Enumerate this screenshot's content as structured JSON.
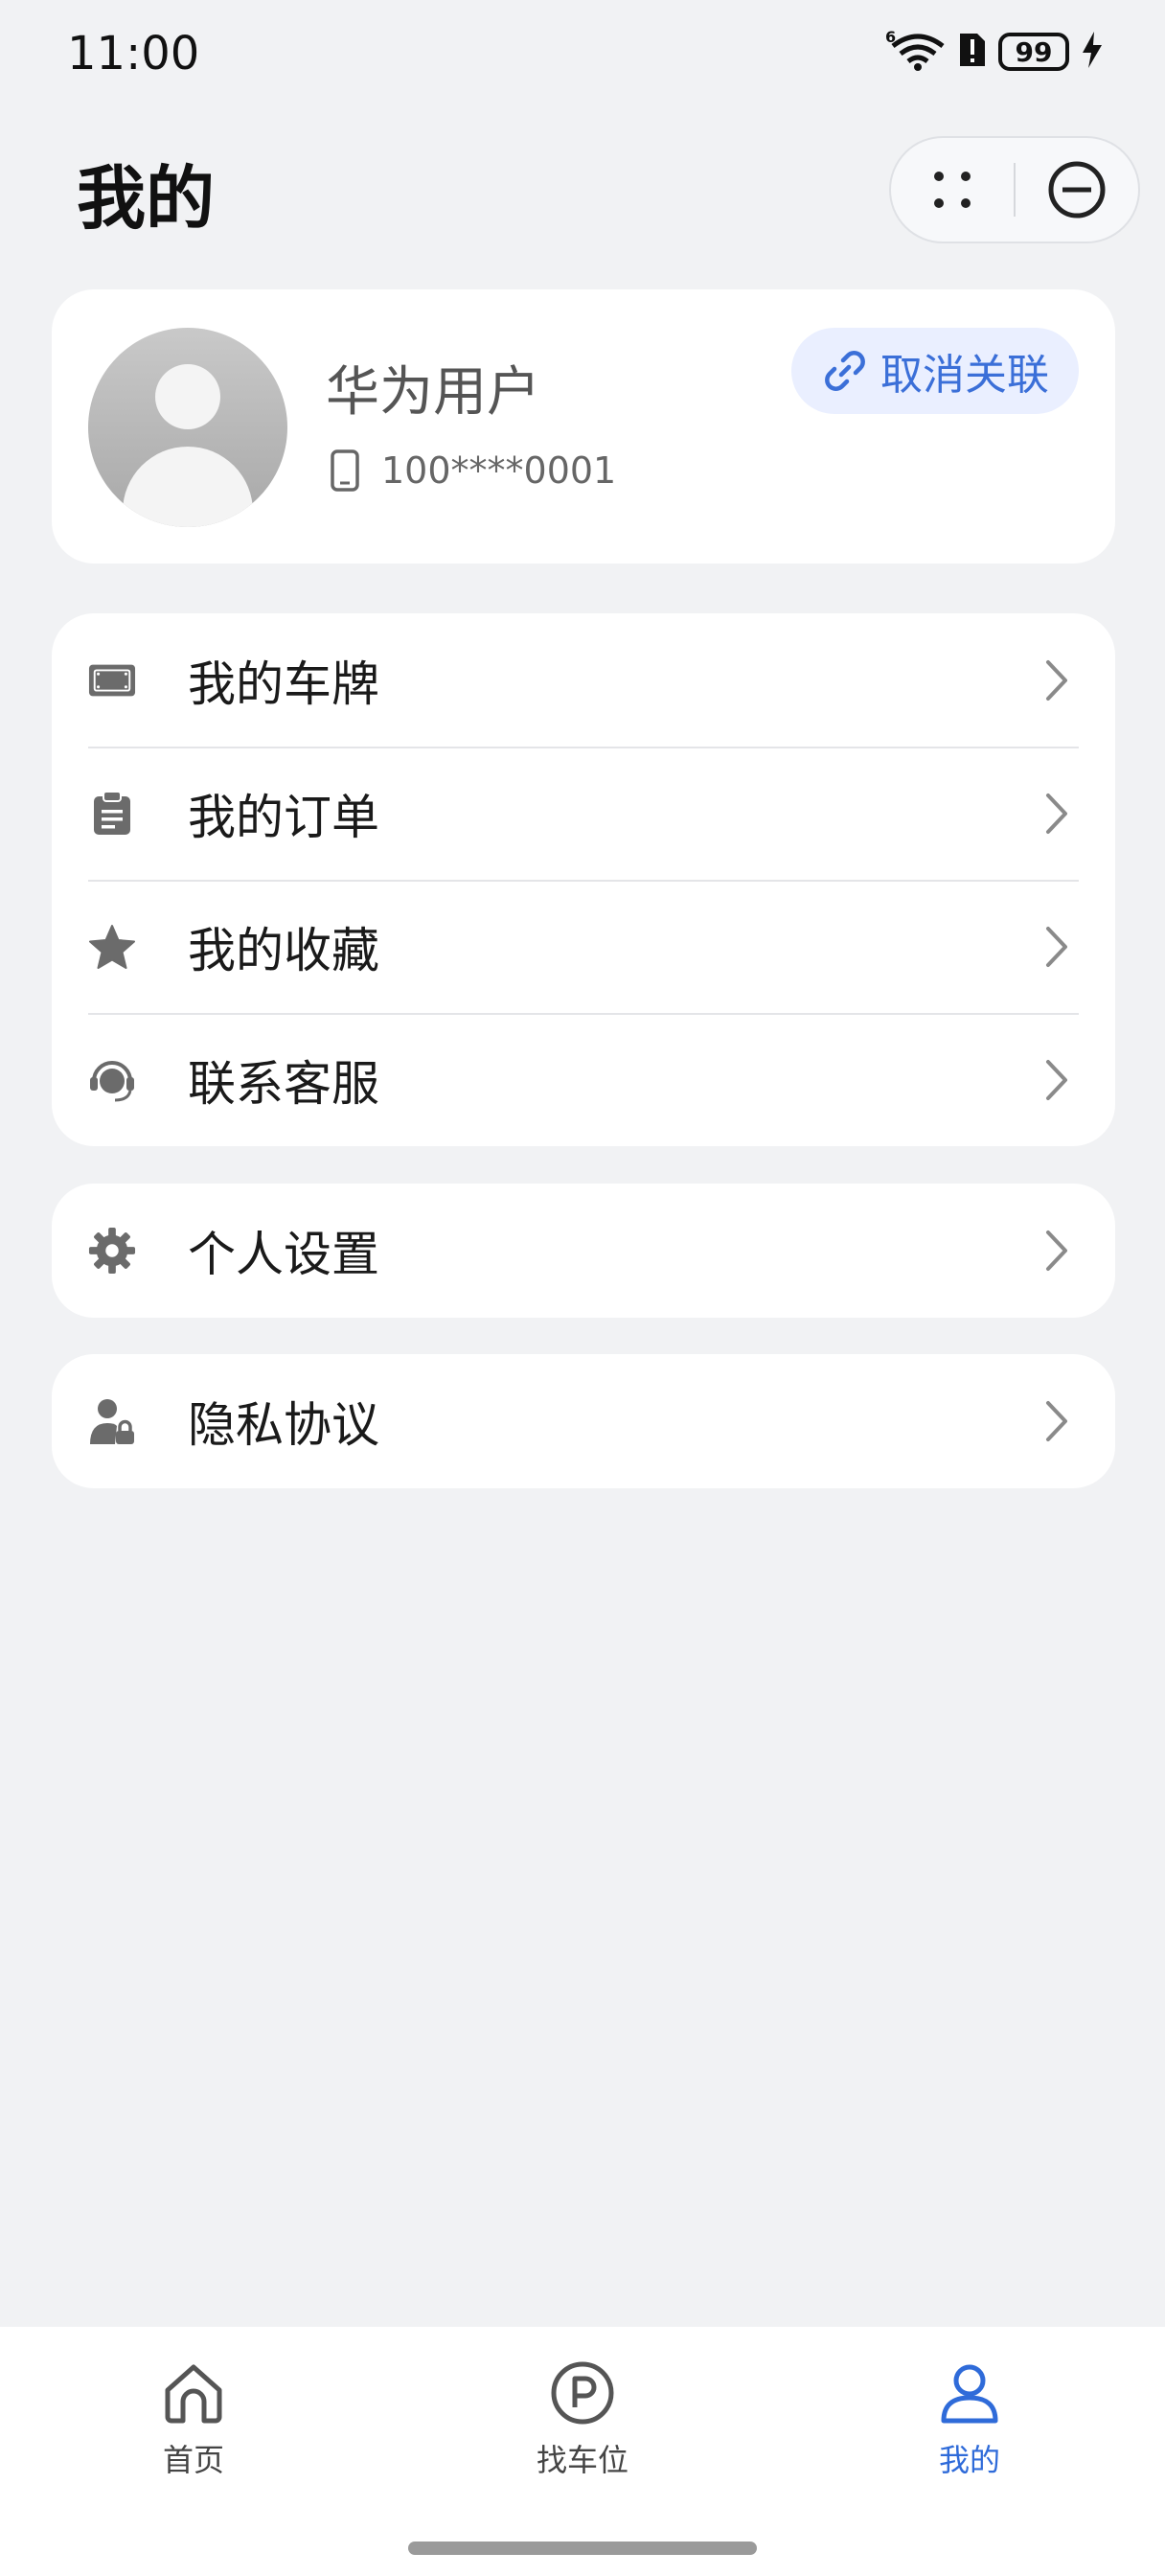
{
  "status": {
    "time": "11:00",
    "battery": "99",
    "network": "6"
  },
  "header": {
    "title": "我的"
  },
  "profile": {
    "name": "华为用户",
    "phone": "100****0001",
    "unlink_label": "取消关联"
  },
  "menu_group_1": [
    {
      "label": "我的车牌",
      "icon": "license-plate-icon"
    },
    {
      "label": "我的订单",
      "icon": "clipboard-icon"
    },
    {
      "label": "我的收藏",
      "icon": "star-icon"
    },
    {
      "label": "联系客服",
      "icon": "headset-icon"
    }
  ],
  "menu_group_2": [
    {
      "label": "个人设置",
      "icon": "gear-icon"
    }
  ],
  "menu_group_3": [
    {
      "label": "隐私协议",
      "icon": "user-lock-icon"
    }
  ],
  "bottom_nav": [
    {
      "label": "首页",
      "icon": "home-icon",
      "active": false
    },
    {
      "label": "找车位",
      "icon": "parking-icon",
      "active": false
    },
    {
      "label": "我的",
      "icon": "person-icon",
      "active": true
    }
  ],
  "colors": {
    "accent": "#2f6bd9",
    "background": "#f1f2f4",
    "card": "#ffffff",
    "icon": "#6b6b6b"
  }
}
